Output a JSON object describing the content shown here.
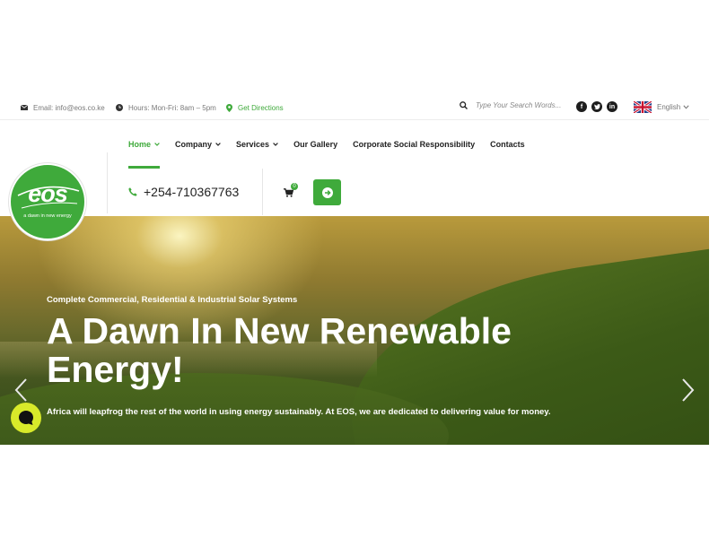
{
  "topbar": {
    "email": "Email: info@eos.co.ke",
    "hours": "Hours: Mon-Fri: 8am – 5pm",
    "directions": "Get Directions",
    "search_placeholder": "Type Your Search Words...",
    "language": "English",
    "social_icons": [
      "facebook-icon",
      "twitter-icon",
      "linkedin-icon"
    ]
  },
  "nav": {
    "items": [
      {
        "label": "Home",
        "dropdown": true,
        "active": true
      },
      {
        "label": "Company",
        "dropdown": true
      },
      {
        "label": "Services",
        "dropdown": true
      },
      {
        "label": "Our Gallery"
      },
      {
        "label": "Corporate Social Responsibility"
      },
      {
        "label": "Contacts"
      }
    ]
  },
  "header": {
    "phone": "+254-710367763",
    "cart_count": "0"
  },
  "logo": {
    "word": "eos",
    "tagline": "a dawn in new energy"
  },
  "hero": {
    "subtitle": "Complete Commercial, Residential & Industrial Solar Systems",
    "title": "A Dawn In New Renewable Energy!",
    "description": "Africa will leapfrog the rest of the world in using energy sustainably. At EOS, we are dedicated to delivering value for money."
  },
  "colors": {
    "accent": "#3faa3b",
    "chat_button": "#d8ea2a"
  }
}
